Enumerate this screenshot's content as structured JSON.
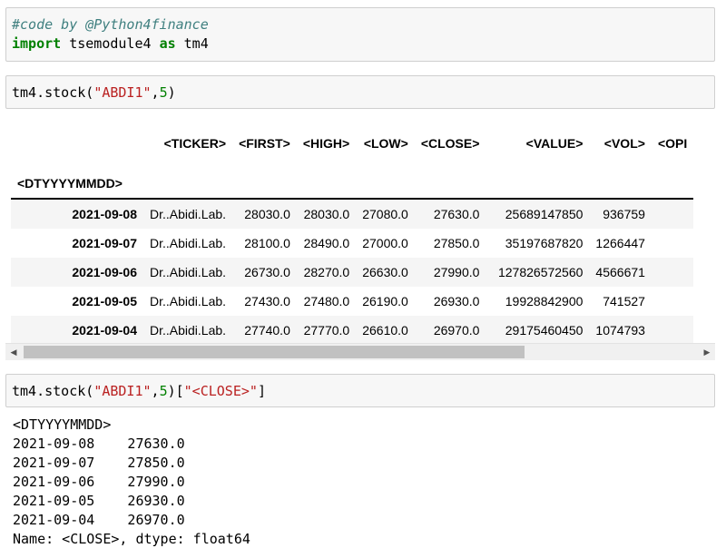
{
  "cell1": {
    "comment": "#code by @Python4finance",
    "kw_import": "import",
    "module": " tsemodule4 ",
    "kw_as": "as",
    "alias": " tm4"
  },
  "cell2": {
    "prefix": "tm4.stock(",
    "arg_str": "\"ABDI1\"",
    "comma": ",",
    "arg_num": "5",
    "suffix": ")"
  },
  "dataframe": {
    "columns": [
      "<TICKER>",
      "<FIRST>",
      "<HIGH>",
      "<LOW>",
      "<CLOSE>",
      "<VALUE>",
      "<VOL>",
      "<OPI"
    ],
    "index_name": "<DTYYYYMMDD>",
    "rows": [
      {
        "date": "2021-09-08",
        "ticker": "Dr..Abidi.Lab.",
        "first": "28030.0",
        "high": "28030.0",
        "low": "27080.0",
        "close": "27630.0",
        "value": "25689147850",
        "vol": "936759"
      },
      {
        "date": "2021-09-07",
        "ticker": "Dr..Abidi.Lab.",
        "first": "28100.0",
        "high": "28490.0",
        "low": "27000.0",
        "close": "27850.0",
        "value": "35197687820",
        "vol": "1266447"
      },
      {
        "date": "2021-09-06",
        "ticker": "Dr..Abidi.Lab.",
        "first": "26730.0",
        "high": "28270.0",
        "low": "26630.0",
        "close": "27990.0",
        "value": "127826572560",
        "vol": "4566671"
      },
      {
        "date": "2021-09-05",
        "ticker": "Dr..Abidi.Lab.",
        "first": "27430.0",
        "high": "27480.0",
        "low": "26190.0",
        "close": "26930.0",
        "value": "19928842900",
        "vol": "741527"
      },
      {
        "date": "2021-09-04",
        "ticker": "Dr..Abidi.Lab.",
        "first": "27740.0",
        "high": "27770.0",
        "low": "26610.0",
        "close": "26970.0",
        "value": "29175460450",
        "vol": "1074793"
      }
    ]
  },
  "scrollbar": {
    "left_arrow": "◀",
    "right_arrow": "▶"
  },
  "cell3": {
    "prefix": "tm4.stock(",
    "arg_str": "\"ABDI1\"",
    "comma": ",",
    "arg_num": "5",
    "mid": ")[",
    "key_str": "\"<CLOSE>\"",
    "suffix": "]"
  },
  "output": {
    "lines": [
      "<DTYYYYMMDD>",
      "2021-09-08    27630.0",
      "2021-09-07    27850.0",
      "2021-09-06    27990.0",
      "2021-09-05    26930.0",
      "2021-09-04    26970.0",
      "Name: <CLOSE>, dtype: float64"
    ]
  }
}
